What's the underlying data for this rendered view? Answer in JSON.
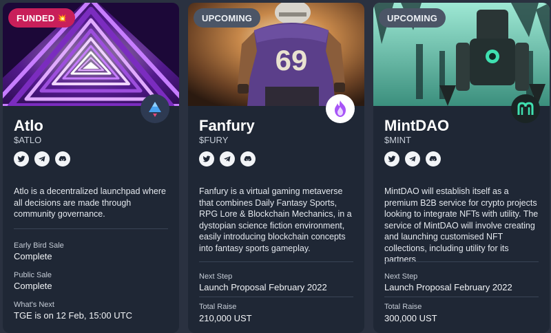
{
  "cards": [
    {
      "status": "FUNDED",
      "status_emoji": "💥",
      "title": "Atlo",
      "ticker": "$ATLO",
      "socials": [
        "twitter-icon",
        "telegram-icon",
        "discord-icon"
      ],
      "description": "Atlo is a decentralized launchpad where all decisions are made through community governance.",
      "fields": [
        {
          "label": "Early Bird Sale",
          "value": "Complete"
        },
        {
          "label": "Public Sale",
          "value": "Complete"
        },
        {
          "label": "What's Next",
          "value": "TGE is on 12 Feb, 15:00 UTC"
        }
      ]
    },
    {
      "status": "UPCOMING",
      "title": "Fanfury",
      "ticker": "$FURY",
      "jersey_number": "69",
      "socials": [
        "twitter-icon",
        "telegram-icon",
        "discord-icon"
      ],
      "description": "Fanfury is a virtual gaming metaverse that combines Daily Fantasy Sports, RPG Lore & Blockchain Mechanics, in a dystopian science fiction environment, easily introducing blockchain concepts into fantasy sports gameplay.",
      "fields": [
        {
          "label": "Next Step",
          "value": "Launch Proposal February 2022"
        },
        {
          "label": "Total Raise",
          "value": "210,000 UST"
        }
      ]
    },
    {
      "status": "UPCOMING",
      "title": "MintDAO",
      "ticker": "$MINT",
      "socials": [
        "twitter-icon",
        "telegram-icon",
        "discord-icon"
      ],
      "description": "MintDAO will establish itself as a premium B2B service for crypto projects looking to integrate NFTs with utility. The service of MintDAO will involve creating and launching customised NFT collections, including utility for its partners",
      "fields": [
        {
          "label": "Next Step",
          "value": "Launch Proposal February 2022"
        },
        {
          "label": "Total Raise",
          "value": "300,000 UST"
        }
      ]
    }
  ],
  "colors": {
    "page_bg": "#2a3140",
    "card_bg": "#1f2735",
    "funded_badge": "#c81f5a",
    "upcoming_badge": "#4b5566"
  }
}
